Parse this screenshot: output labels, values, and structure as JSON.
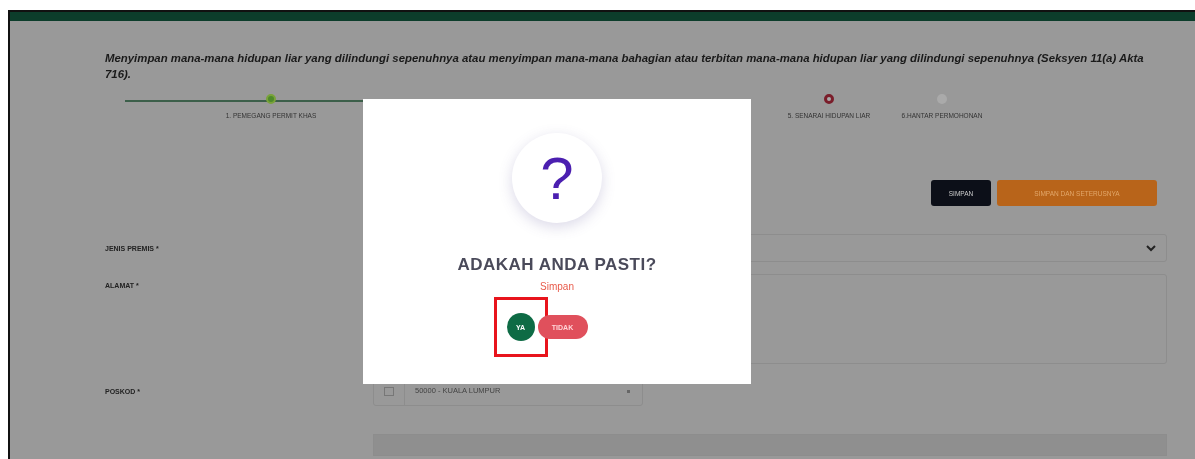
{
  "intro": "Menyimpan mana-mana hidupan liar yang dilindungi sepenuhnya atau menyimpan mana-mana bahagian atau terbitan mana-mana hidupan liar yang dilindungi sepenuhnya (Seksyen 11(a) Akta 716).",
  "steps": [
    {
      "label": "1. PEMEGANG PERMIT KHAS",
      "completed": true,
      "selected": false
    },
    {
      "label": "5. SENARAI HIDUPAN LIAR",
      "completed": false,
      "selected": true
    },
    {
      "label": "6.HANTAR PERMOHONAN",
      "completed": false,
      "selected": false
    }
  ],
  "actions": [
    {
      "label": "SIMPAN",
      "kind": "dark"
    },
    {
      "label": "SIMPAN DAN SETERUSNYA",
      "kind": "orange"
    }
  ],
  "form": {
    "premis_label": "JENIS PREMIS *",
    "alamat_label": "ALAMAT *",
    "poskod_label": "POSKOD *",
    "poskod_value": "50000 - KUALA LUMPUR"
  },
  "dialog": {
    "icon": "?",
    "title": "ADAKAH ANDA PASTI?",
    "message": "Simpan",
    "buttons": [
      {
        "label": "YA",
        "kind": "confirm",
        "highlighted": true
      },
      {
        "label": "TIDAK",
        "kind": "cancel",
        "highlighted": false
      }
    ]
  }
}
